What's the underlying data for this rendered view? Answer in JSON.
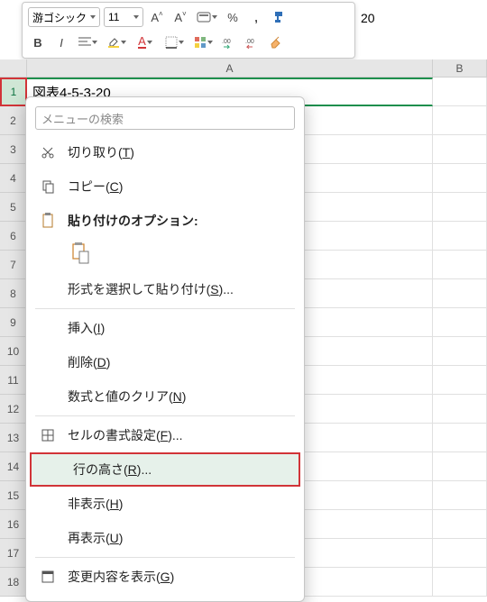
{
  "toolbar": {
    "font_name": "游ゴシック",
    "font_size": "11"
  },
  "overflow_text": "20",
  "grid": {
    "columns": [
      "A",
      "B"
    ],
    "rows": [
      1,
      2,
      3,
      4,
      5,
      6,
      7,
      8,
      9,
      10,
      11,
      12,
      13,
      14,
      15,
      16,
      17,
      18
    ],
    "selected_row": 1,
    "cell_a1": "図表4-5-3-20"
  },
  "context_menu": {
    "search_placeholder": "メニューの検索",
    "cut": "切り取り",
    "cut_key": "T",
    "copy": "コピー",
    "copy_key": "C",
    "paste_section": "貼り付けのオプション:",
    "paste_special": "形式を選択して貼り付け",
    "paste_special_key": "S",
    "insert": "挿入",
    "insert_key": "I",
    "delete": "削除",
    "delete_key": "D",
    "clear": "数式と値のクリア",
    "clear_key": "N",
    "format_cells": "セルの書式設定",
    "format_cells_key": "F",
    "row_height": "行の高さ",
    "row_height_key": "R",
    "hide": "非表示",
    "hide_key": "H",
    "unhide": "再表示",
    "unhide_key": "U",
    "show_changes": "変更内容を表示",
    "show_changes_key": "G"
  }
}
